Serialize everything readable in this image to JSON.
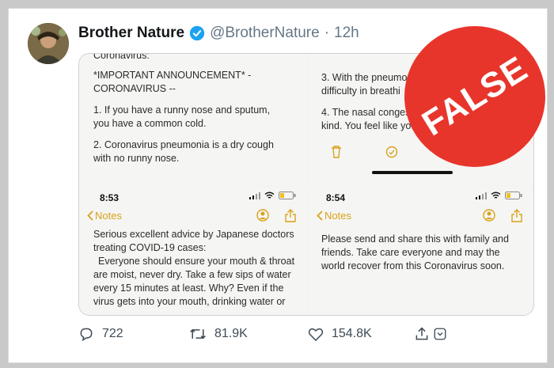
{
  "tweet": {
    "display_name": "Brother Nature",
    "handle": "@BrotherNature",
    "separator": "·",
    "timestamp": "12h"
  },
  "screenshot": {
    "top_left": {
      "lines": [
        "Coronavirus:",
        "*IMPORTANT ANNOUNCEMENT* - CORONAVIRUS --",
        "1. If you have a runny nose and sputum, you have a common cold.",
        "2. Coronavirus pneumonia is a dry cough with no runny nose."
      ]
    },
    "top_right": {
      "lines": [
        "3. With the pneumo",
        "difficulty in breathi",
        "4. The nasal congest",
        "kind. You feel like you'r"
      ]
    },
    "bottom_left": {
      "time": "8:53",
      "back_label": "Notes",
      "lines": [
        "Serious excellent advice by Japanese doctors treating COVID-19 cases:",
        "Everyone should ensure your mouth & throat are moist, never dry. Take a few sips of water every 15 minutes at least. Why? Even if the virus gets into your mouth, drinking water or"
      ]
    },
    "bottom_right": {
      "time": "8:54",
      "back_label": "Notes",
      "lines": [
        "Please send and share this with family and friends. Take care everyone and may the world recover from this Coronavirus soon."
      ]
    }
  },
  "actions": {
    "replies": "722",
    "retweets": "81.9K",
    "likes": "154.8K"
  },
  "stamp": {
    "label": "FALSE",
    "color": "#e8352c"
  },
  "icons": {
    "verified": "verified-badge-icon",
    "reply": "reply-icon",
    "retweet": "retweet-icon",
    "like": "heart-icon",
    "share": "share-icon",
    "more": "chevron-down-icon"
  },
  "colors": {
    "notes_accent": "#d9a21b",
    "verified_blue": "#1da1f2"
  }
}
